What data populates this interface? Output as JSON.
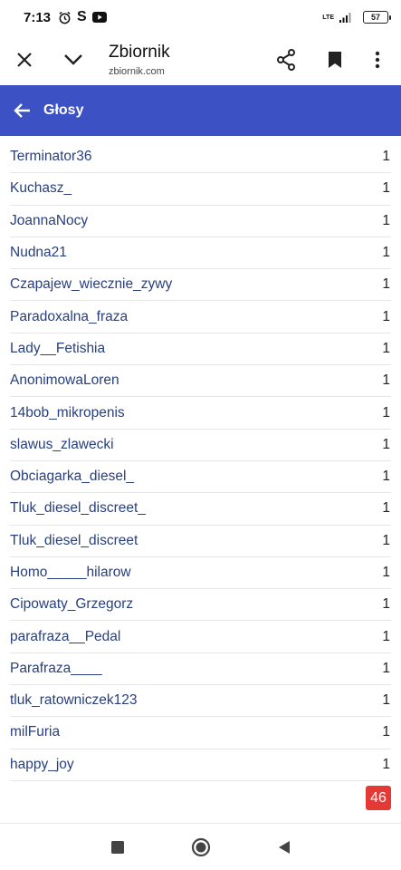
{
  "status_bar": {
    "time": "7:13",
    "icons": [
      "alarm-icon",
      "s-app-icon",
      "youtube-icon"
    ],
    "network": "LTE",
    "battery": "57"
  },
  "browser": {
    "title": "Zbiornik",
    "url": "zbiornik.com",
    "icons": [
      "close-icon",
      "chevron-down-icon",
      "share-icon",
      "bookmark-icon",
      "more-vert-icon"
    ]
  },
  "app_header": {
    "title": "Głosy",
    "back_icon": "arrow-left-icon",
    "background": "#3b51c4"
  },
  "votes": [
    {
      "name": "Terminator36",
      "count": "1"
    },
    {
      "name": "Kuchasz_",
      "count": "1"
    },
    {
      "name": "JoannaNocy",
      "count": "1"
    },
    {
      "name": "Nudna21",
      "count": "1"
    },
    {
      "name": "Czapajew_wiecznie_zywy",
      "count": "1"
    },
    {
      "name": "Paradoxalna_fraza",
      "count": "1"
    },
    {
      "name": "Lady__Fetishia",
      "count": "1"
    },
    {
      "name": "AnonimowaLoren",
      "count": "1"
    },
    {
      "name": "14bob_mikropenis",
      "count": "1"
    },
    {
      "name": "slawus_zlawecki",
      "count": "1"
    },
    {
      "name": "Obciagarka_diesel_",
      "count": "1"
    },
    {
      "name": "Tluk_diesel_discreet_",
      "count": "1"
    },
    {
      "name": "Tluk_diesel_discreet",
      "count": "1"
    },
    {
      "name": "Homo_____hilarow",
      "count": "1"
    },
    {
      "name": "Cipowaty_Grzegorz",
      "count": "1"
    },
    {
      "name": "parafraza__Pedal",
      "count": "1"
    },
    {
      "name": "Parafraza____",
      "count": "1"
    },
    {
      "name": "tluk_ratowniczek123",
      "count": "1"
    },
    {
      "name": "milFuria",
      "count": "1"
    },
    {
      "name": "happy_joy",
      "count": "1"
    }
  ],
  "badge": {
    "value": "46",
    "color": "#e53935"
  },
  "nav_bar": {
    "icons": [
      "recents-square-icon",
      "home-circle-icon",
      "back-triangle-icon"
    ]
  }
}
